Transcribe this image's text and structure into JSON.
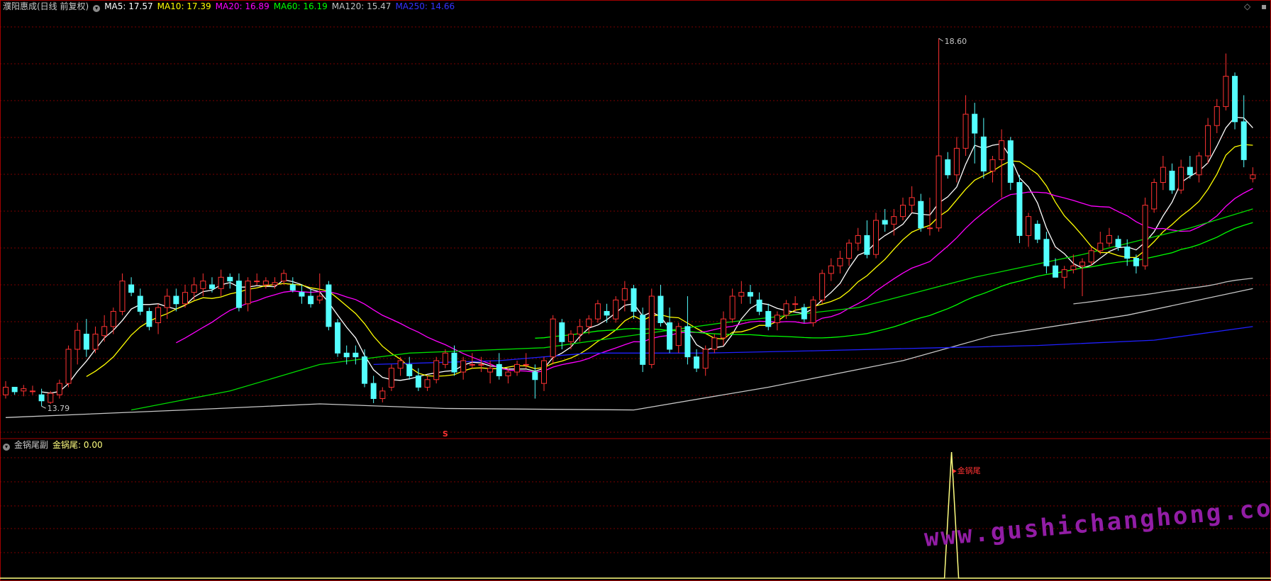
{
  "header": {
    "title": "濮阳惠成(日线 前复权)",
    "ma": [
      {
        "label": "MA5: 17.57",
        "color": "#ffffff"
      },
      {
        "label": "MA10: 17.39",
        "color": "#ffff00"
      },
      {
        "label": "MA20: 16.89",
        "color": "#ff00ff"
      },
      {
        "label": "MA60: 16.19",
        "color": "#00ff00"
      },
      {
        "label": "MA120: 15.47",
        "color": "#c0c0c0"
      },
      {
        "label": "MA250: 14.66",
        "color": "#3333ff"
      }
    ]
  },
  "indicator_header": {
    "name": "金锅尾副",
    "value_label": "金锅尾: 0.00"
  },
  "annotations": {
    "high_label": "18.60",
    "low_label": "13.79",
    "marker_s": "S",
    "signal_label": "金锅尾"
  },
  "watermark": "www.gushichanghong.com",
  "colors": {
    "up": "#ff3232",
    "down": "#54ffff",
    "grid": "#7a0000",
    "signal": "#ffff80"
  },
  "chart_data": {
    "type": "candlestick",
    "y_range": [
      13.5,
      18.9
    ],
    "bar_count": 140,
    "candles": [
      [
        13.9,
        14.08,
        13.85,
        14.0
      ],
      [
        14.0,
        14.0,
        13.9,
        13.94
      ],
      [
        13.95,
        14.03,
        13.88,
        13.98
      ],
      [
        13.95,
        14.02,
        13.9,
        13.95
      ],
      [
        13.9,
        13.98,
        13.75,
        13.82
      ],
      [
        13.8,
        13.95,
        13.78,
        13.92
      ],
      [
        13.9,
        14.1,
        13.85,
        14.05
      ],
      [
        14.05,
        14.55,
        14.0,
        14.5
      ],
      [
        14.5,
        14.85,
        14.3,
        14.75
      ],
      [
        14.7,
        14.9,
        14.4,
        14.5
      ],
      [
        14.5,
        14.8,
        14.45,
        14.7
      ],
      [
        14.68,
        14.95,
        14.6,
        14.8
      ],
      [
        14.8,
        15.05,
        14.7,
        15.0
      ],
      [
        15.0,
        15.5,
        14.95,
        15.4
      ],
      [
        15.35,
        15.45,
        15.2,
        15.25
      ],
      [
        15.2,
        15.3,
        14.95,
        15.0
      ],
      [
        15.0,
        15.05,
        14.75,
        14.8
      ],
      [
        14.85,
        15.1,
        14.7,
        15.05
      ],
      [
        15.05,
        15.3,
        14.9,
        15.2
      ],
      [
        15.2,
        15.3,
        15.0,
        15.1
      ],
      [
        15.1,
        15.35,
        15.05,
        15.25
      ],
      [
        15.25,
        15.45,
        15.15,
        15.35
      ],
      [
        15.3,
        15.5,
        15.2,
        15.4
      ],
      [
        15.35,
        15.45,
        15.25,
        15.3
      ],
      [
        15.3,
        15.55,
        15.2,
        15.45
      ],
      [
        15.45,
        15.5,
        15.3,
        15.4
      ],
      [
        15.4,
        15.5,
        15.0,
        15.05
      ],
      [
        15.1,
        15.45,
        15.0,
        15.4
      ],
      [
        15.4,
        15.5,
        15.35,
        15.4
      ],
      [
        15.35,
        15.45,
        15.3,
        15.4
      ],
      [
        15.35,
        15.45,
        15.3,
        15.38
      ],
      [
        15.4,
        15.55,
        15.35,
        15.5
      ],
      [
        15.35,
        15.45,
        15.25,
        15.28
      ],
      [
        15.25,
        15.35,
        15.1,
        15.2
      ],
      [
        15.2,
        15.3,
        15.05,
        15.1
      ],
      [
        15.15,
        15.5,
        15.1,
        15.2
      ],
      [
        15.35,
        15.4,
        14.75,
        14.8
      ],
      [
        14.85,
        14.9,
        14.4,
        14.45
      ],
      [
        14.45,
        14.55,
        14.3,
        14.4
      ],
      [
        14.45,
        14.55,
        14.3,
        14.4
      ],
      [
        14.4,
        14.5,
        14.0,
        14.05
      ],
      [
        14.05,
        14.15,
        13.79,
        13.85
      ],
      [
        13.85,
        14.0,
        13.8,
        13.95
      ],
      [
        14.0,
        14.3,
        13.95,
        14.25
      ],
      [
        14.25,
        14.4,
        14.15,
        14.35
      ],
      [
        14.3,
        14.4,
        14.1,
        14.15
      ],
      [
        14.15,
        14.25,
        13.95,
        14.0
      ],
      [
        14.0,
        14.15,
        13.95,
        14.1
      ],
      [
        14.1,
        14.4,
        14.05,
        14.35
      ],
      [
        14.3,
        14.5,
        14.25,
        14.45
      ],
      [
        14.45,
        14.55,
        14.15,
        14.2
      ],
      [
        14.2,
        14.4,
        14.1,
        14.35
      ],
      [
        14.3,
        14.45,
        14.25,
        14.3
      ],
      [
        14.3,
        14.4,
        14.2,
        14.3
      ],
      [
        14.2,
        14.35,
        14.05,
        14.25
      ],
      [
        14.3,
        14.45,
        14.1,
        14.15
      ],
      [
        14.15,
        14.25,
        14.05,
        14.2
      ],
      [
        14.2,
        14.35,
        14.15,
        14.3
      ],
      [
        14.3,
        14.45,
        14.25,
        14.3
      ],
      [
        14.2,
        14.3,
        13.85,
        14.1
      ],
      [
        14.05,
        14.4,
        13.95,
        14.35
      ],
      [
        14.4,
        14.95,
        14.3,
        14.9
      ],
      [
        14.85,
        14.9,
        14.5,
        14.6
      ],
      [
        14.6,
        14.75,
        14.5,
        14.7
      ],
      [
        14.7,
        14.9,
        14.6,
        14.8
      ],
      [
        14.8,
        14.95,
        14.7,
        14.9
      ],
      [
        14.9,
        15.15,
        14.85,
        15.1
      ],
      [
        15.0,
        15.1,
        14.85,
        14.95
      ],
      [
        14.9,
        15.2,
        14.85,
        15.15
      ],
      [
        15.15,
        15.4,
        15.0,
        15.3
      ],
      [
        15.3,
        15.35,
        14.9,
        15.0
      ],
      [
        14.95,
        15.05,
        14.2,
        14.3
      ],
      [
        14.3,
        15.3,
        14.25,
        15.2
      ],
      [
        15.2,
        15.35,
        14.8,
        14.85
      ],
      [
        14.85,
        15.05,
        14.45,
        14.5
      ],
      [
        14.55,
        14.85,
        14.45,
        14.8
      ],
      [
        14.8,
        15.2,
        14.3,
        14.4
      ],
      [
        14.4,
        14.5,
        14.2,
        14.25
      ],
      [
        14.25,
        14.55,
        14.15,
        14.5
      ],
      [
        14.5,
        14.7,
        14.45,
        14.65
      ],
      [
        14.65,
        15.0,
        14.55,
        14.9
      ],
      [
        14.9,
        15.3,
        14.85,
        15.2
      ],
      [
        15.2,
        15.4,
        15.1,
        15.25
      ],
      [
        15.25,
        15.35,
        15.1,
        15.2
      ],
      [
        15.15,
        15.25,
        14.95,
        15.0
      ],
      [
        15.0,
        15.1,
        14.75,
        14.8
      ],
      [
        14.85,
        15.0,
        14.75,
        14.95
      ],
      [
        14.95,
        15.15,
        14.9,
        15.1
      ],
      [
        15.1,
        15.2,
        15.0,
        15.1
      ],
      [
        15.05,
        15.1,
        14.85,
        14.9
      ],
      [
        14.85,
        15.2,
        14.8,
        15.15
      ],
      [
        15.15,
        15.55,
        15.1,
        15.5
      ],
      [
        15.5,
        15.7,
        15.4,
        15.6
      ],
      [
        15.6,
        15.8,
        15.5,
        15.7
      ],
      [
        15.7,
        15.95,
        15.6,
        15.9
      ],
      [
        15.9,
        16.1,
        15.8,
        16.0
      ],
      [
        16.0,
        16.2,
        15.7,
        15.75
      ],
      [
        15.75,
        16.3,
        15.7,
        16.2
      ],
      [
        16.2,
        16.35,
        16.05,
        16.15
      ],
      [
        16.15,
        16.35,
        16.0,
        16.25
      ],
      [
        16.25,
        16.5,
        16.2,
        16.4
      ],
      [
        16.4,
        16.65,
        16.3,
        16.5
      ],
      [
        16.45,
        16.55,
        16.05,
        16.1
      ],
      [
        16.1,
        16.5,
        16.0,
        16.1
      ],
      [
        16.1,
        18.6,
        16.05,
        17.05
      ],
      [
        17.0,
        17.1,
        16.75,
        16.8
      ],
      [
        16.8,
        17.3,
        16.7,
        17.15
      ],
      [
        17.15,
        17.85,
        17.05,
        17.6
      ],
      [
        17.6,
        17.75,
        16.95,
        17.35
      ],
      [
        17.3,
        17.55,
        16.75,
        16.85
      ],
      [
        16.85,
        17.05,
        16.7,
        17.0
      ],
      [
        17.0,
        17.4,
        16.5,
        17.25
      ],
      [
        17.25,
        17.3,
        16.6,
        16.7
      ],
      [
        16.7,
        16.8,
        15.9,
        16.0
      ],
      [
        16.0,
        16.3,
        15.85,
        16.25
      ],
      [
        16.15,
        16.2,
        15.9,
        15.95
      ],
      [
        15.95,
        16.05,
        15.5,
        15.6
      ],
      [
        15.6,
        15.7,
        15.45,
        15.45
      ],
      [
        15.45,
        15.6,
        15.3,
        15.55
      ],
      [
        15.55,
        15.75,
        15.5,
        15.6
      ],
      [
        15.6,
        15.7,
        15.2,
        15.65
      ],
      [
        15.65,
        15.85,
        15.6,
        15.8
      ],
      [
        15.8,
        16.05,
        15.75,
        15.9
      ],
      [
        15.9,
        16.1,
        15.85,
        16.0
      ],
      [
        15.95,
        16.0,
        15.8,
        15.85
      ],
      [
        15.85,
        15.95,
        15.6,
        15.7
      ],
      [
        15.7,
        15.75,
        15.5,
        15.6
      ],
      [
        15.6,
        16.5,
        15.55,
        16.4
      ],
      [
        16.35,
        16.75,
        16.3,
        16.7
      ],
      [
        16.7,
        17.05,
        16.6,
        16.9
      ],
      [
        16.85,
        16.95,
        16.55,
        16.6
      ],
      [
        16.6,
        17.0,
        16.55,
        16.9
      ],
      [
        16.9,
        17.05,
        16.75,
        16.8
      ],
      [
        16.8,
        17.1,
        16.7,
        17.05
      ],
      [
        17.05,
        17.55,
        16.95,
        17.45
      ],
      [
        17.45,
        17.8,
        17.35,
        17.7
      ],
      [
        17.7,
        18.4,
        17.65,
        18.1
      ],
      [
        18.1,
        18.15,
        17.4,
        17.5
      ],
      [
        17.5,
        17.85,
        16.9,
        17.0
      ],
      [
        16.75,
        16.9,
        16.7,
        16.8
      ]
    ]
  }
}
